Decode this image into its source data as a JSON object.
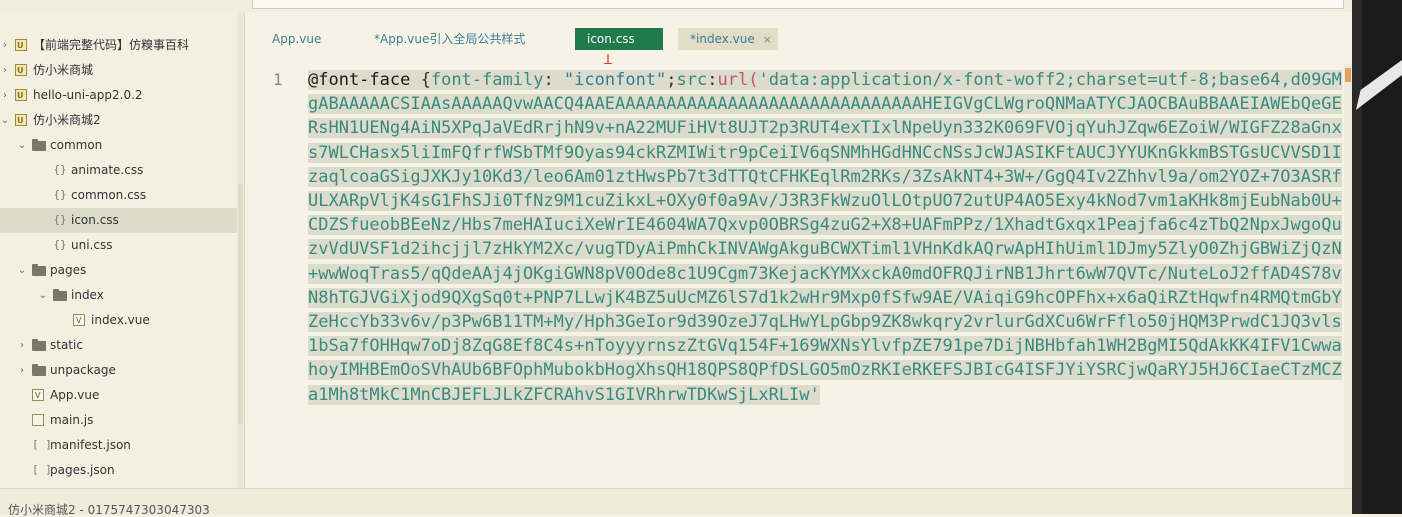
{
  "sidebar": {
    "items": [
      {
        "label": "【前端完整代码】仿糗事百科",
        "icon": "project-icon",
        "level": 0,
        "expanded": false,
        "selected": false
      },
      {
        "label": "仿小米商城",
        "icon": "project-icon",
        "level": 0,
        "expanded": false,
        "selected": false
      },
      {
        "label": "hello-uni-app2.0.2",
        "icon": "project-icon",
        "level": 0,
        "expanded": false,
        "selected": false
      },
      {
        "label": "仿小米商城2",
        "icon": "project-icon",
        "level": 0,
        "expanded": true,
        "selected": false
      },
      {
        "label": "common",
        "icon": "folder-icon",
        "level": 1,
        "expanded": true,
        "selected": false
      },
      {
        "label": "animate.css",
        "icon": "css-file-icon",
        "level": 2,
        "selected": false
      },
      {
        "label": "common.css",
        "icon": "css-file-icon",
        "level": 2,
        "selected": false
      },
      {
        "label": "icon.css",
        "icon": "css-file-icon",
        "level": 2,
        "selected": true
      },
      {
        "label": "uni.css",
        "icon": "css-file-icon",
        "level": 2,
        "selected": false
      },
      {
        "label": "pages",
        "icon": "folder-icon",
        "level": 1,
        "expanded": true,
        "selected": false
      },
      {
        "label": "index",
        "icon": "folder-icon",
        "level": 2,
        "expanded": true,
        "selected": false
      },
      {
        "label": "index.vue",
        "icon": "vue-file-icon",
        "level": 3,
        "selected": false
      },
      {
        "label": "static",
        "icon": "folder-icon",
        "level": 1,
        "expanded": false,
        "selected": false
      },
      {
        "label": "unpackage",
        "icon": "folder-icon",
        "level": 1,
        "expanded": false,
        "selected": false
      },
      {
        "label": "App.vue",
        "icon": "vue-file-icon",
        "level": 1,
        "selected": false
      },
      {
        "label": "main.js",
        "icon": "js-file-icon",
        "level": 1,
        "selected": false
      },
      {
        "label": "manifest.json",
        "icon": "json-file-icon",
        "level": 1,
        "selected": false
      },
      {
        "label": "pages.json",
        "icon": "json-file-icon",
        "level": 1,
        "selected": false
      }
    ]
  },
  "tabs": [
    {
      "label": "App.vue",
      "state": "normal"
    },
    {
      "label": "*App.vue引入全局公共样式",
      "state": "normal"
    },
    {
      "label": "icon.css",
      "state": "active"
    },
    {
      "label": "*index.vue",
      "state": "hover",
      "close": "×"
    }
  ],
  "editor": {
    "line_number": "1",
    "code": {
      "at_rule": "@font-face",
      "open": " {",
      "prop1": "font-family",
      "colon1": ": ",
      "str1": "\"iconfont\"",
      "semi1": ";",
      "prop2": "src",
      "colon2": ":",
      "fn": "url(",
      "body": "'data:application/x-font-woff2;charset=utf-8;base64,d09GMgABAAAAACSIAAsAAAAAQvwAACQ4AAEAAAAAAAAAAAAAAAAAAAAAAAAAAAAAAHEIGVgCLWgroQNMaATYCJAOCBAuBBAAEIAWEbQeGERsHN1UENg4AiN5XPqJaVEdRrjhN9v+nA22MUFiHVt8UJT2p3RUT4exTIxlNpeUyn332K069FVOjqYuhJZqw6EZoiW/WIGFZ28aGnxs7WLCHasx5liImFQfrfWSbTMf9Oyas94ckRZMIWitr9pCeiIV6qSNMhHGdHNCcNSsJcWJASIKFtAUCJYYUKnGkkmBSTGsUCVVSD1IzaqlcoaGSigJXKJy10Kd3/leo6Am01ztHwsPb7t3dTTQtCFHKEqlRm2RKs/3ZsAkNT4+3W+/GgQ4Iv2Zhhvl9a/om2YOZ+7O3ASRfULXARpVljK4sG1FhSJi0TfNz9M1cuZikxL+OXy0f0a9Av/J3R3FkWzuOlLOtpUO72utUP4AO5Exy4kNod7vm1aKHk8mjEubNab0U+CDZSfueobBEeNz/Hbs7meHAIuciXeWrIE4604WA7Qxvp0OBRSg4zuG2+X8+UAFmPPz/1XhadtGxqx1Peajfa6c4zTbQ2NpxJwgoQuzvVdUVSF1d2ihcjjl7zHkYM2Xc/vugTDyAiPmhCkINVAWgAkguBCWXTiml1VHnKdkAQrwApHIhUiml1DJmy5ZlyO0ZhjGBWiZjQzN+wwWoqTras5/qQdeAAj4jOKgiGWN8pV0Ode8c1U9Cgm73KejacKYMXxckA0mdOFRQJirNB1Jhrt6wW7QVTc/NuteLoJ2ffAD4S78vN8hTGJVGiXjod9QXgSq0t+PNP7LLwjK4BZ5uUcMZ6lS7d1k2wHr9Mxp0fSfw9AE/VAiqiG9hcOPFhx+x6aQiRZtHqwfn4RMQtmGbYZeHccYb33v6v/p3Pw6B11TM+My/Hph3GeIor9d39OzeJ7qLHwYLpGbp9ZK8wkqry2vrlurGdXCu6WrFflo50jHQM3PrwdC1JQ3vls1bSa7fOHHqw7oDj8ZqG8Ef8C4s+nToyyyrnszZtGVq154F+169WXNsYlvfpZE791pe7DijNBHbfah1WH2BgMI5QdAkKK4IFV1CwwahoyIMHBEmOoSVhAUb6BFOphMubokbHogXhsQH18QPS8QPfDSLGO5mOzRKIeRKEFSJBIcG4ISFJYiYSRCjwQaRYJ5HJ6CIaeCTzMCZa1Mh8tMkC1MnCBJEFLJLkZFCRAhvS1GIVRhrwTDKwSjLxRLIw'"
    }
  },
  "status": {
    "text": "仿小米商城2 - 0175747303047303"
  },
  "colors": {
    "active_tab": "#1f7a4c",
    "code_text": "#3a8a80",
    "string": "#2e7d9a",
    "function": "#c0567a",
    "selection": "#dcdccc",
    "background": "#f6f3e6"
  }
}
